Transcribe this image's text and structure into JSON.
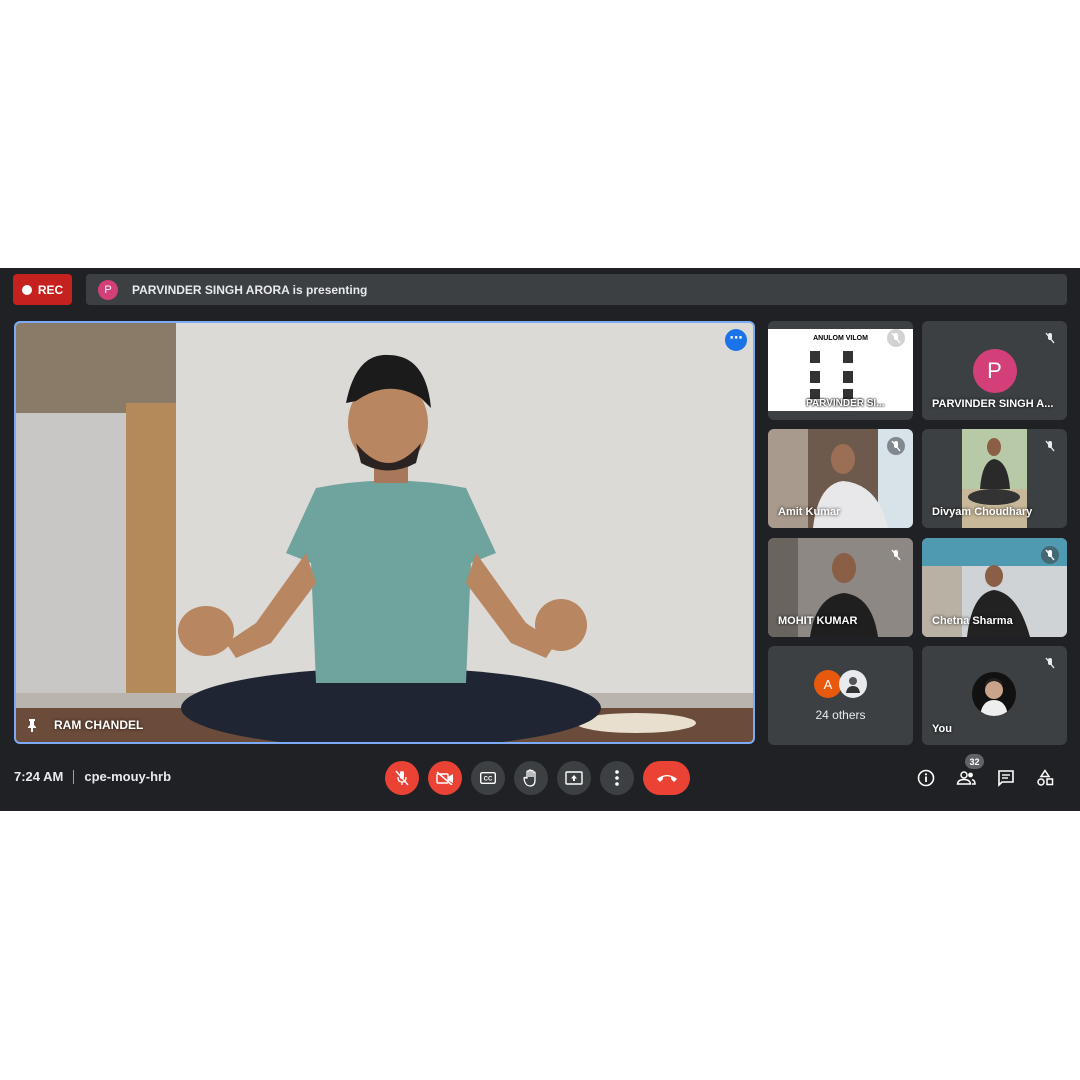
{
  "recording": {
    "label": "REC"
  },
  "presenter_banner": {
    "avatar_letter": "P",
    "text": "PARVINDER SINGH ARORA is presenting"
  },
  "main_video": {
    "participant_name": "RAM CHANDEL",
    "more_options": "⋯"
  },
  "participants": [
    {
      "slide_title": "ANULOM VILOM",
      "name": "PARVINDER SI..."
    },
    {
      "avatar_letter": "P",
      "name": "PARVINDER SINGH A..."
    },
    {
      "name": "Amit Kumar"
    },
    {
      "name": "Divyam Choudhary"
    },
    {
      "name": "MOHIT KUMAR"
    },
    {
      "name": "Chetna Sharma"
    },
    {
      "avatar_letter": "A",
      "label": "24 others"
    },
    {
      "name": "You"
    }
  ],
  "bottom_bar": {
    "time": "7:24 AM",
    "meeting_code": "cpe-mouy-hrb",
    "participant_count": "32"
  },
  "colors": {
    "background": "#202124",
    "tile": "#3c4043",
    "danger": "#ea4335",
    "accent": "#1a73e8"
  }
}
